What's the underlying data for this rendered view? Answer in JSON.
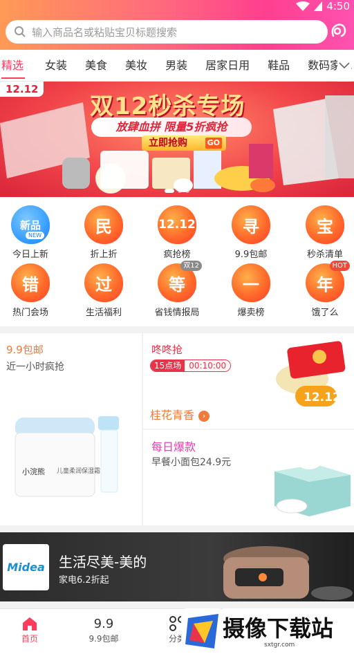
{
  "status_bar": {
    "time": "4:50"
  },
  "search": {
    "placeholder": "输入商品名或粘贴宝贝标题搜索"
  },
  "tabs": [
    "精选",
    "女装",
    "美食",
    "美妆",
    "男装",
    "居家日用",
    "鞋品",
    "数码家电"
  ],
  "banner": {
    "badge": "12.12",
    "title": "双12秒杀专场",
    "slogan": "放肆血拼 限量5折疯抢",
    "button": "立即抢购",
    "button_go": "GO"
  },
  "categories": [
    {
      "icon": "新品",
      "badge": "NEW",
      "label": "今日上新"
    },
    {
      "icon": "民",
      "label": "折上折"
    },
    {
      "icon": "12.12",
      "label": "疯抢榜"
    },
    {
      "icon": "寻",
      "label": "9.9包邮"
    },
    {
      "icon": "宝",
      "label": "秒杀清单"
    },
    {
      "icon": "错",
      "label": "热门会场"
    },
    {
      "icon": "过",
      "label": "生活福利"
    },
    {
      "icon": "等",
      "badge": "双12",
      "label": "省钱情报局"
    },
    {
      "icon": "一",
      "label": "爆卖榜"
    },
    {
      "icon": "年",
      "badge": "HOT",
      "label": "饿了么"
    }
  ],
  "promo": {
    "left_title": "9.9包邮",
    "left_sub": "近一小时疯抢",
    "product_brand": "小浣熊",
    "product_name": "儿童柔润保湿霜",
    "flash_title": "咚咚抢",
    "flash_session": "15点场",
    "flash_timer": "00:10:00",
    "flash_badge": "12.12",
    "osmanthus": "桂花青香",
    "daily_title": "每日爆款",
    "daily_sub": "早餐小面包24.9元"
  },
  "brand_banner": {
    "logo": "Midea",
    "title": "生活尽美-美的",
    "sub": "家电6.2折起"
  },
  "bottom_nav": [
    {
      "label": "首页"
    },
    {
      "label": "9.9包邮"
    },
    {
      "label": "分类"
    }
  ],
  "watermark": {
    "title": "摄像下载站",
    "url": "sxtgr.com"
  },
  "colors": {
    "accent": "#ff3d5a",
    "header_start": "#ff9a56",
    "header_end": "#ff52b0",
    "promo_red": "#e8344a",
    "promo_pink": "#e93db0",
    "promo_orange": "#f07a3a"
  }
}
